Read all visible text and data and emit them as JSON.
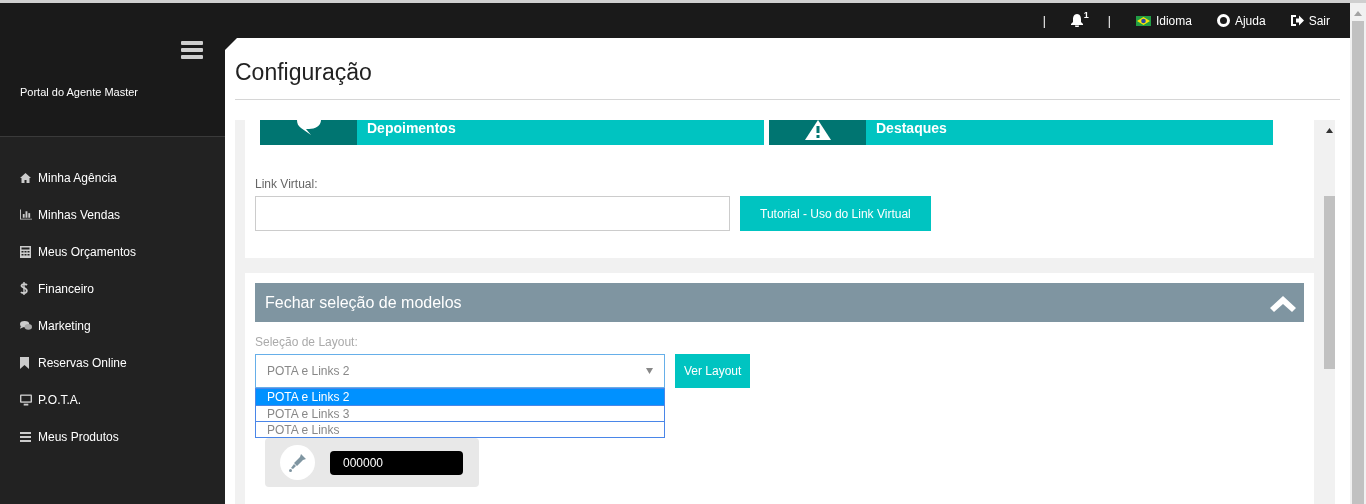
{
  "topbar": {
    "items": [
      {
        "kind": "separator",
        "text": "|"
      },
      {
        "kind": "bell",
        "badge": "1"
      },
      {
        "kind": "separator",
        "text": "|"
      },
      {
        "kind": "flag",
        "label": "Idioma"
      },
      {
        "kind": "help",
        "label": "Ajuda"
      },
      {
        "kind": "exit",
        "label": "Sair"
      }
    ]
  },
  "sidebar": {
    "title": "Portal do Agente Master",
    "items": [
      {
        "kind": "home",
        "label": "Minha Agência"
      },
      {
        "kind": "chart",
        "label": "Minhas Vendas"
      },
      {
        "kind": "calculator",
        "label": "Meus Orçamentos"
      },
      {
        "kind": "dollar",
        "label": "Financeiro"
      },
      {
        "kind": "comments",
        "label": "Marketing"
      },
      {
        "kind": "bookmark",
        "label": "Reservas Online"
      },
      {
        "kind": "monitor",
        "label": "P.O.T.A."
      },
      {
        "kind": "list",
        "label": "Meus Produtos"
      }
    ]
  },
  "page": {
    "title": "Configuração"
  },
  "tiles": [
    {
      "kind": "comment",
      "label": "Depoimentos"
    },
    {
      "kind": "warning",
      "label": "Destaques"
    }
  ],
  "link_virtual": {
    "label": "Link Virtual:",
    "button": "Tutorial - Uso do Link Virtual"
  },
  "models": {
    "header": "Fechar seleção de modelos",
    "expanded": true,
    "select_label": "Seleção de Layout:",
    "value": "POTA e Links 2",
    "button": "Ver Layout",
    "options": [
      {
        "label": "POTA e Links 2",
        "selected": true
      },
      {
        "label": "POTA e Links 3",
        "selected": false
      },
      {
        "label": "POTA e Links",
        "selected": false
      }
    ],
    "color_value": "000000"
  }
}
